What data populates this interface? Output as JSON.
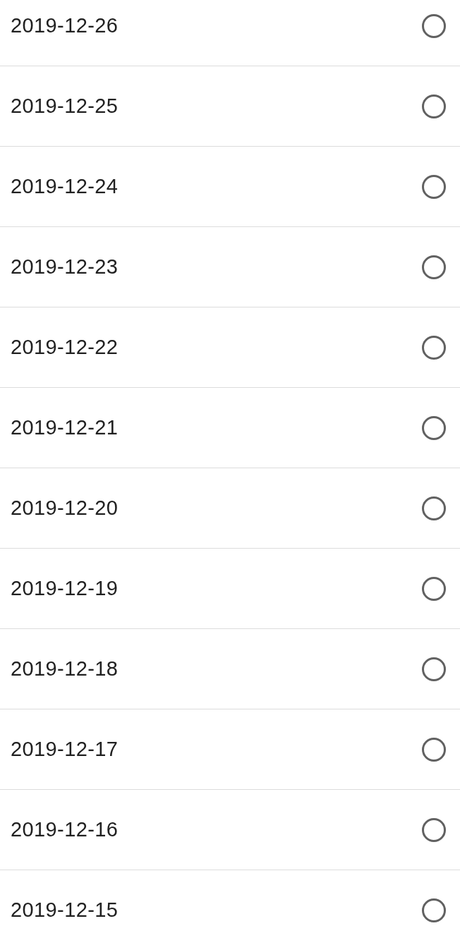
{
  "rows": [
    {
      "date": "2019-12-26",
      "selected": false
    },
    {
      "date": "2019-12-25",
      "selected": false
    },
    {
      "date": "2019-12-24",
      "selected": false
    },
    {
      "date": "2019-12-23",
      "selected": false
    },
    {
      "date": "2019-12-22",
      "selected": false
    },
    {
      "date": "2019-12-21",
      "selected": false
    },
    {
      "date": "2019-12-20",
      "selected": false
    },
    {
      "date": "2019-12-19",
      "selected": false
    },
    {
      "date": "2019-12-18",
      "selected": false
    },
    {
      "date": "2019-12-17",
      "selected": false
    },
    {
      "date": "2019-12-16",
      "selected": false
    },
    {
      "date": "2019-12-15",
      "selected": false
    }
  ]
}
